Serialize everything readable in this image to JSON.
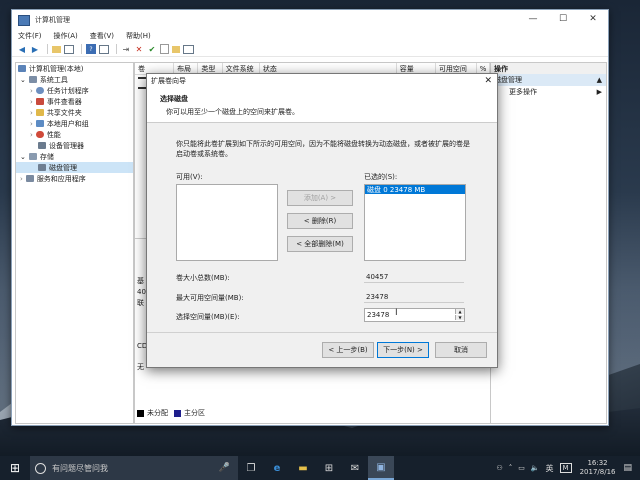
{
  "window": {
    "title": "计算机管理",
    "min_label": "—",
    "max_label": "☐",
    "close_label": "✕"
  },
  "menu": [
    "文件(F)",
    "操作(A)",
    "查看(V)",
    "帮助(H)"
  ],
  "tree": {
    "root": "计算机管理(本地)",
    "system_tools": "系统工具",
    "task_scheduler": "任务计划程序",
    "event_viewer": "事件查看器",
    "shared_folders": "共享文件夹",
    "local_users": "本地用户和组",
    "performance": "性能",
    "device_manager": "设备管理器",
    "storage": "存储",
    "disk_management": "磁盘管理",
    "services": "服务和应用程序"
  },
  "center": {
    "columns": [
      "卷",
      "布局",
      "类型",
      "文件系统",
      "状态",
      "容量",
      "可用空间",
      "%"
    ],
    "frag_a": "基",
    "frag_b": "40",
    "frag_c": "联",
    "frag_d": "CD",
    "frag_e": "无"
  },
  "actions": {
    "header": "操作",
    "section": "磁盘管理",
    "more": "更多操作"
  },
  "legend": {
    "unallocated": "未分配",
    "primary": "主分区",
    "unallocated_color": "#000000",
    "primary_color": "#1e1e8c"
  },
  "dialog": {
    "title": "扩展卷向导",
    "close": "✕",
    "heading": "选择磁盘",
    "subheading": "你可以用至少一个磁盘上的空间来扩展卷。",
    "description": "你只能将此卷扩展到如下所示的可用空间，因为不能将磁盘转换为动态磁盘，或者被扩展的卷是启动卷或系统卷。",
    "available_label": "可用(V):",
    "selected_label": "已选的(S):",
    "add_button": "添加(A) >",
    "remove_button": "< 删除(R)",
    "remove_all_button": "< 全部删除(M)",
    "selected_items": [
      "磁盘 0     23478 MB"
    ],
    "total_size_label": "卷大小总数(MB):",
    "total_size_value": "40457",
    "max_space_label": "最大可用空间量(MB):",
    "max_space_value": "23478",
    "select_space_label": "选择空间量(MB)(E):",
    "select_space_value": "23478",
    "back_button": "< 上一步(B)",
    "next_button": "下一步(N) >",
    "cancel_button": "取消"
  },
  "taskbar": {
    "search_placeholder": "有问题尽管问我",
    "ime": "英",
    "time": "16:32",
    "date": "2017/8/16"
  }
}
